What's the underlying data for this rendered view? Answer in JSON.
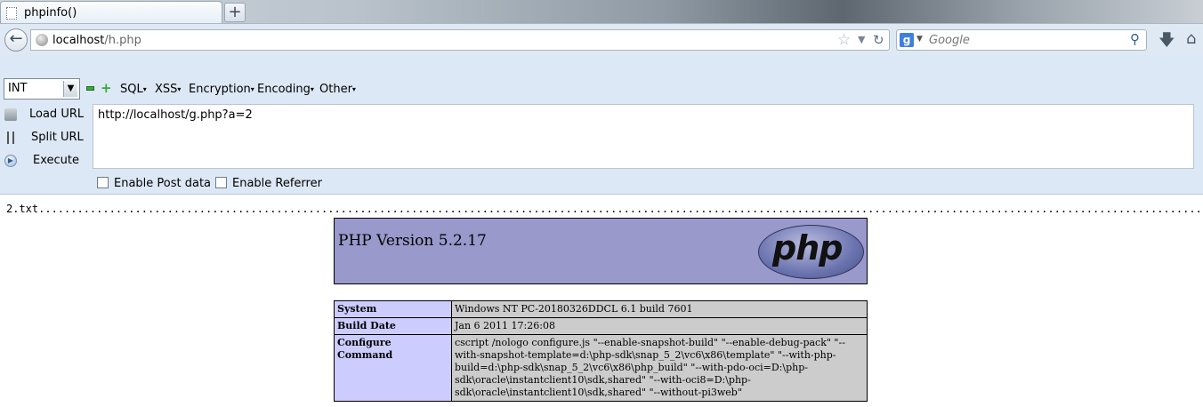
{
  "tab": {
    "title": "phpinfo()",
    "new_tab": "+"
  },
  "nav": {
    "url_host": "localhost",
    "url_path": "/h.php",
    "search_engine": "g",
    "search_placeholder": "Google",
    "icons": [
      "back-arrow-icon",
      "globe-icon",
      "star-icon",
      "reload-icon",
      "search-icon",
      "download-icon",
      "home-icon"
    ]
  },
  "hackbar": {
    "select_value": "INT",
    "menus": [
      "SQL",
      "XSS",
      "Encryption",
      "Encoding",
      "Other"
    ],
    "load_url": "Load URL",
    "split_url": "Split URL",
    "execute": "Execute",
    "url_value": "http://localhost/g.php?a=2",
    "enable_post": "Enable Post data",
    "enable_referrer": "Enable Referrer"
  },
  "page": {
    "leading_text": "2.txt",
    "dots": "...........................................................................................................................................................................................",
    "php_version": "PHP Version 5.2.17",
    "logo_text": "php",
    "rows": [
      {
        "key": "System",
        "value": "Windows NT PC-20180326DDCL 6.1 build 7601"
      },
      {
        "key": "Build Date",
        "value": "Jan 6 2011 17:26:08"
      },
      {
        "key": "Configure Command",
        "value": "cscript /nologo configure.js \"--enable-snapshot-build\" \"--enable-debug-pack\" \"--with-snapshot-template=d:\\php-sdk\\snap_5_2\\vc6\\x86\\template\" \"--with-php-build=d:\\php-sdk\\snap_5_2\\vc6\\x86\\php_build\" \"--with-pdo-oci=D:\\php-sdk\\oracle\\instantclient10\\sdk,shared\" \"--with-oci8=D:\\php-sdk\\oracle\\instantclient10\\sdk,shared\" \"--without-pi3web\""
      }
    ]
  },
  "colors": {
    "php_header_bg": "#9999cc",
    "key_bg": "#ccccff",
    "value_bg": "#cccccc",
    "hackbar_bg": "#dce8f5"
  }
}
